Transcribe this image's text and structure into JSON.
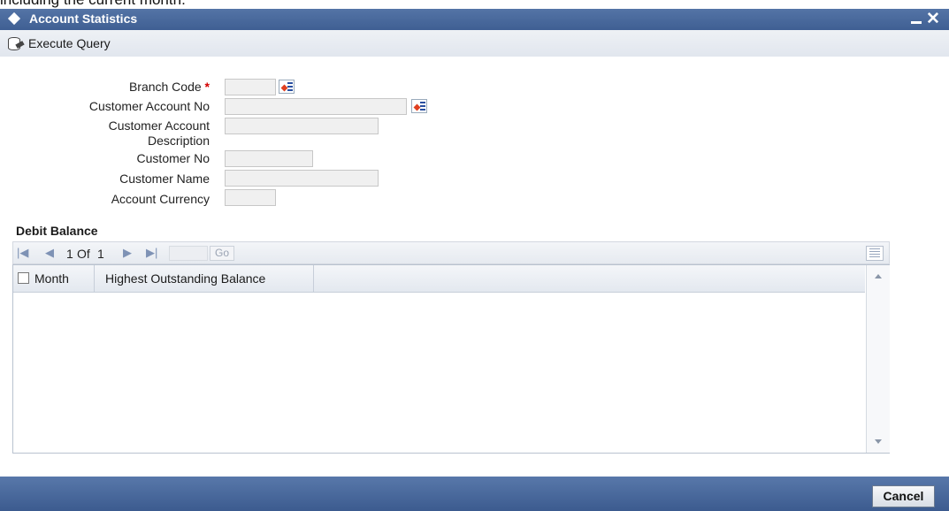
{
  "page": {
    "cropped_text": "including the current month."
  },
  "window": {
    "title": "Account Statistics",
    "minimize_icon": "minimize-icon",
    "close_symbol": "✕"
  },
  "toolbar": {
    "execute_query_label": "Execute Query",
    "execute_query_icon": "database-query-icon"
  },
  "form": {
    "branch_code_label": "Branch Code",
    "required_mark": "*",
    "customer_account_no_label": "Customer Account No",
    "customer_account_description_label_line1": "Customer Account",
    "customer_account_description_label_line2": "Description",
    "customer_no_label": "Customer No",
    "customer_name_label": "Customer Name",
    "account_currency_label": "Account Currency",
    "branch_code_value": "",
    "customer_account_no_value": "",
    "customer_account_description_value": "",
    "customer_no_value": "",
    "customer_name_value": "",
    "account_currency_value": ""
  },
  "debit_balance": {
    "title": "Debit Balance",
    "page_current": "1",
    "page_of": "Of",
    "page_total": "1",
    "page_input_value": "",
    "go_label": "Go",
    "columns": [
      "Month",
      "Highest Outstanding Balance"
    ],
    "rows": []
  },
  "footer": {
    "cancel_label": "Cancel"
  },
  "colors": {
    "titlebar": "#4a6a9e",
    "required": "#d40000",
    "lov_arrow": "#e04020"
  }
}
